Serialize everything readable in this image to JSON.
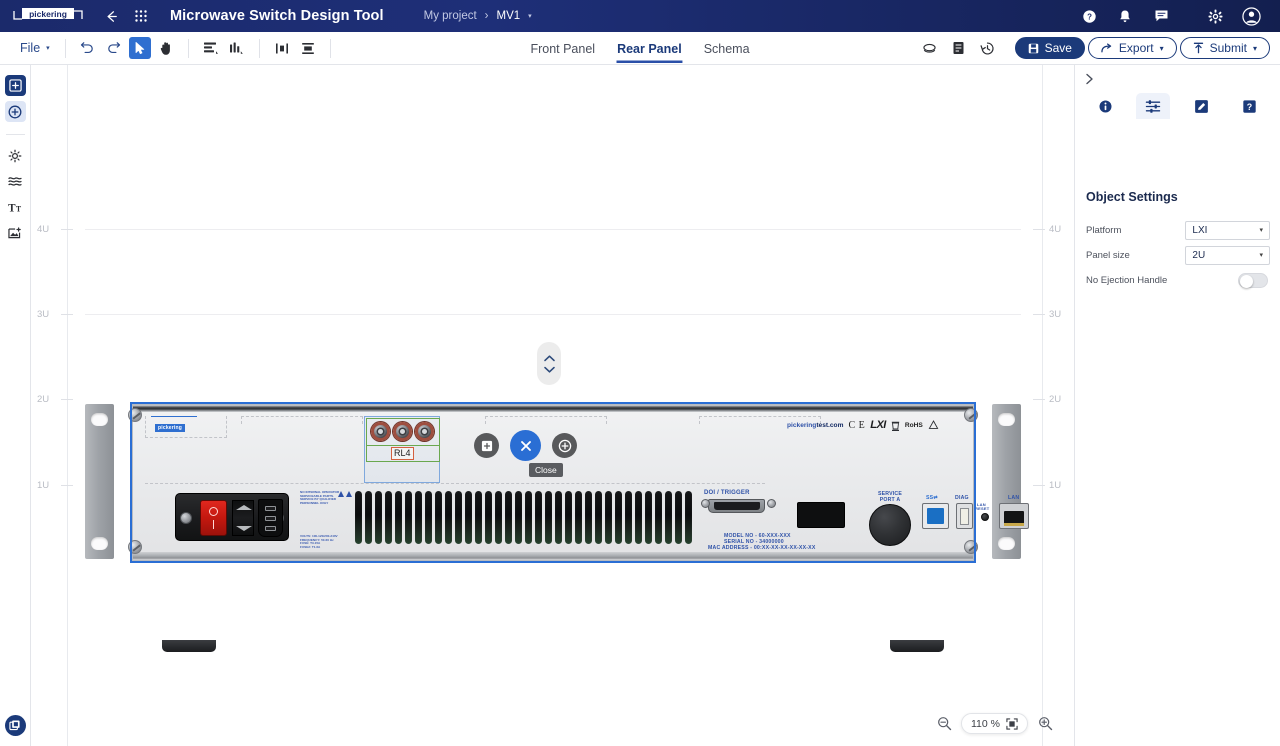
{
  "header": {
    "logo_text": "pickering",
    "back_icon": "back-arrow-icon",
    "apps_icon": "apps-grid-icon",
    "title": "Microwave Switch Design Tool",
    "breadcrumb": {
      "project": "My project",
      "separator": "›",
      "item": "MV1",
      "caret": "▾"
    },
    "icons": {
      "help": "help-icon",
      "notifications": "bell-icon",
      "messages": "chat-icon",
      "settings": "gear-icon",
      "account": "avatar-icon"
    }
  },
  "toolbar": {
    "file_label": "File",
    "file_caret": "▾",
    "undo": "undo-icon",
    "redo": "redo-icon",
    "select_tool": "cursor-icon",
    "pan_tool": "hand-icon",
    "align_tool": "align-icon",
    "distribute_tool": "distribute-icon",
    "align_center_h": "align-center-horizontal-icon",
    "align_center_v": "align-center-vertical-icon",
    "attach": "attachment-icon",
    "notes": "notes-icon",
    "history": "history-icon",
    "save_label": "Save",
    "export_label": "Export",
    "submit_label": "Submit",
    "caret": "▾"
  },
  "tabs": [
    {
      "label": "Front Panel",
      "active": false
    },
    {
      "label": "Rear Panel",
      "active": true
    },
    {
      "label": "Schema",
      "active": false
    }
  ],
  "left_rail": [
    {
      "name": "add-module-button",
      "icon": "plus-square-icon",
      "state": "filled"
    },
    {
      "name": "add-connector-button",
      "icon": "plus-circle-icon",
      "state": "selected"
    },
    {
      "name": "led-tool-button",
      "icon": "led-icon",
      "state": "default"
    },
    {
      "name": "wave-tool-button",
      "icon": "waves-icon",
      "state": "default"
    },
    {
      "name": "text-tool-button",
      "icon": "text-icon",
      "state": "default"
    },
    {
      "name": "image-tool-button",
      "icon": "add-image-icon",
      "state": "default"
    }
  ],
  "rail_bottom_icon": "layers-library-icon",
  "canvas": {
    "ruler_units": [
      "4U",
      "3U",
      "2U",
      "1U"
    ],
    "scroller": {
      "up": "chevron-up-icon",
      "down": "chevron-down-icon"
    },
    "fabs": [
      {
        "name": "add-panel-button",
        "icon": "plus-square-icon",
        "style": "dark"
      },
      {
        "name": "close-button",
        "icon": "close-icon",
        "style": "primary"
      },
      {
        "name": "add-circle-button",
        "icon": "plus-circle-icon",
        "style": "dark"
      }
    ],
    "tooltip": "Close",
    "zoom": {
      "out_icon": "zoom-out-icon",
      "level": "110 %",
      "fit_icon": "fit-to-screen-icon",
      "in_icon": "zoom-in-icon"
    }
  },
  "device": {
    "module_label": "RL4",
    "module_logo": "pickering",
    "branding": {
      "website_a": "pickering",
      "website_b": "test.com",
      "ce": "C E",
      "lxi": "LXI",
      "weee": "weee-bin-icon",
      "rohs": "RoHS",
      "recycle": "recycle-icon"
    },
    "rear_labels": {
      "doi_trigger": "DOI / TRIGGER",
      "service_port": "SERVICE\nPORT A",
      "usb3": "SS⇄",
      "diag": "DIAG",
      "lan_reset": "LAN\nRESET",
      "lan": "LAN"
    },
    "id_plate": [
      "MODEL NO - 60-XXX-XXX",
      "SERIAL NO - 34000000",
      "MAC ADDRESS - 00:XX-XX-XX-XX-XX-XX"
    ],
    "warning_text": [
      "NO INTERNAL OPERATOR",
      "SERVICEABLE PARTS.",
      "SERVICE BY QUALIFIED",
      "PERSONNEL ONLY"
    ],
    "power_text": [
      "VOLTS: 100-120/200-240V",
      "FREQUENCY: 50-60 Hz",
      "FUSE: T3.15A",
      "FUSE2: T1.6A"
    ],
    "switch_marks": {
      "off": "O",
      "on": "I"
    }
  },
  "right_panel": {
    "collapse_icon": "chevron-right-icon",
    "tabs": [
      {
        "name": "tab-info",
        "icon": "info-icon",
        "active": false
      },
      {
        "name": "tab-object-settings",
        "icon": "sliders-icon",
        "active": true
      },
      {
        "name": "tab-edit",
        "icon": "edit-icon",
        "active": false
      },
      {
        "name": "tab-help",
        "icon": "question-icon",
        "active": false
      }
    ],
    "title": "Object Settings",
    "fields": [
      {
        "label": "Platform",
        "value": "LXI",
        "type": "select"
      },
      {
        "label": "Panel size",
        "value": "2U",
        "type": "select"
      },
      {
        "label": "No Ejection Handle",
        "value": "off",
        "type": "toggle"
      }
    ],
    "caret": "▾"
  }
}
